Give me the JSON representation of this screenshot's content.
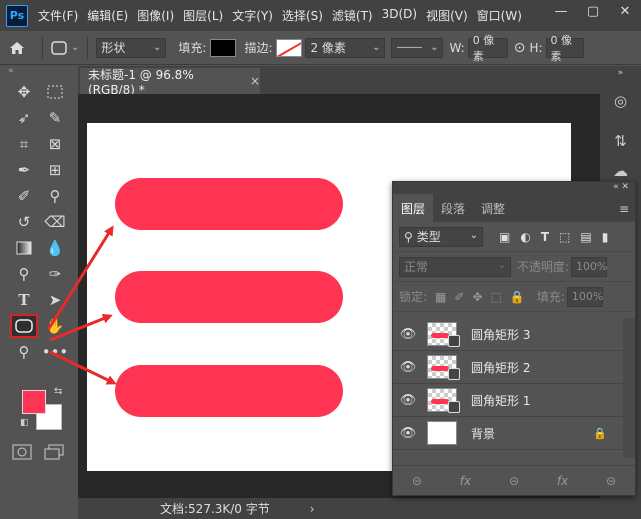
{
  "app": {
    "logo": "Ps"
  },
  "menu": {
    "items": [
      "文件(F)",
      "编辑(E)",
      "图像(I)",
      "图层(L)",
      "文字(Y)",
      "选择(S)",
      "滤镜(T)",
      "3D(D)",
      "视图(V)",
      "窗口(W)"
    ]
  },
  "window_controls": {
    "minimize": "—",
    "restore": "▢",
    "close": "✕"
  },
  "options": {
    "mode_value": "形状",
    "fill_label": "填充:",
    "stroke_label": "描边:",
    "stroke_width": "2 像素",
    "w_label": "W:",
    "w_value": "0 像素",
    "h_label": "H:",
    "h_value": "0 像素",
    "stroke_style": "———"
  },
  "document": {
    "tab_title": "未标题-1 @ 96.8%(RGB/8) *",
    "tab_close": "×",
    "status": "文档:527.3K/0 字节",
    "status_arrow": "›"
  },
  "colors": {
    "foreground": "#ff3352",
    "background": "#ffffff",
    "pill": "#ff3352",
    "arrow": "#e82a2a"
  },
  "layers_panel": {
    "tabs": [
      "图层",
      "段落",
      "调整"
    ],
    "filter_label": "类型",
    "blend_mode": "正常",
    "opacity_label": "不透明度:",
    "opacity_value": "100%",
    "lock_label": "锁定:",
    "fill_label": "填充:",
    "fill_value": "100%",
    "layers": [
      {
        "name": "圆角矩形 3"
      },
      {
        "name": "圆角矩形 2"
      },
      {
        "name": "圆角矩形 1"
      },
      {
        "name": "背景"
      }
    ]
  }
}
